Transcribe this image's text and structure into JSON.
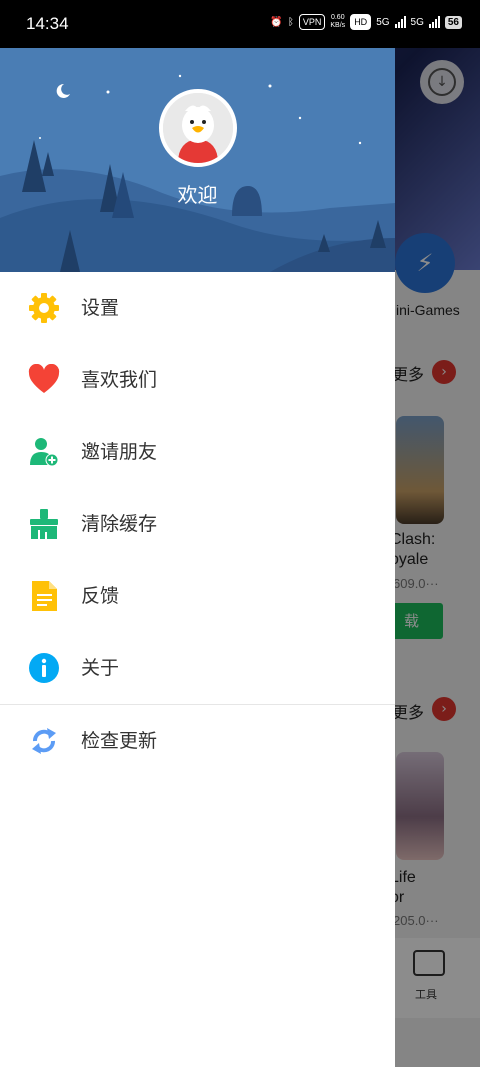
{
  "status_bar": {
    "time": "14:34",
    "vpn": "VPN",
    "speed_value": "0.60",
    "speed_unit": "KB/s",
    "hd": "HD",
    "net1": "5G",
    "net2": "5G",
    "battery": "56"
  },
  "background_app": {
    "mini_games_label": "ini-Games",
    "more_label_1": "更多",
    "more_label_2": "更多",
    "game1_name_line1": "Clash:",
    "game1_name_line2": "oyale",
    "game1_size": "609.0···",
    "game1_button": "载",
    "game2_name_line1": "Life",
    "game2_name_line2": "or",
    "game2_size": "205.0···",
    "tab_tools_label": "工具"
  },
  "drawer": {
    "welcome": "欢迎",
    "menu": [
      {
        "label": "设置",
        "icon": "gear-icon",
        "color": "#FFC107"
      },
      {
        "label": "喜欢我们",
        "icon": "heart-icon",
        "color": "#F44336"
      },
      {
        "label": "邀请朋友",
        "icon": "add-user-icon",
        "color": "#1DB878"
      },
      {
        "label": "清除缓存",
        "icon": "broom-icon",
        "color": "#1DB878"
      },
      {
        "label": "反馈",
        "icon": "document-icon",
        "color": "#FFC107"
      },
      {
        "label": "关于",
        "icon": "info-icon",
        "color": "#03A9F4"
      },
      {
        "label": "检查更新",
        "icon": "refresh-icon",
        "color": "#5C9CF5"
      }
    ]
  }
}
